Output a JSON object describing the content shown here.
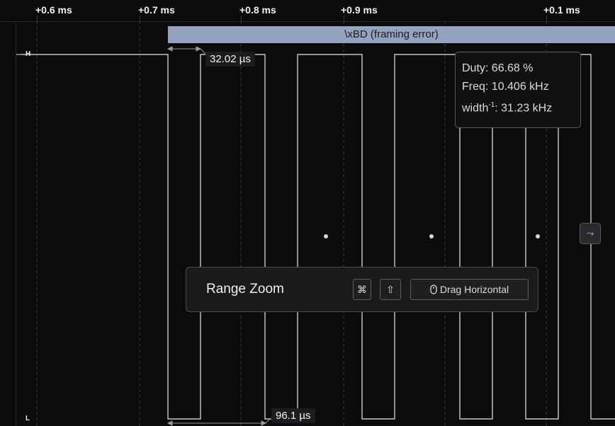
{
  "time_axis": {
    "ticks": [
      "+0.6 ms",
      "+0.7 ms",
      "+0.8 ms",
      "+0.9 ms",
      "+0.1 ms"
    ]
  },
  "levels": {
    "high": "H",
    "low": "L"
  },
  "decoder": {
    "label": "\\xBD (framing error)",
    "color": "#93a3bd"
  },
  "measurements": {
    "pulse_width": "32.02 µs",
    "period": "96.1 µs"
  },
  "stats": {
    "duty": "Duty: 66.68 %",
    "freq": "Freq: 10.406 kHz",
    "width_inverse_prefix": "width",
    "width_inverse_sup": "-1",
    "width_inverse_value": ": 31.23 kHz"
  },
  "side_button": {
    "icon": "measure-toggle-icon",
    "glyph": "⤳"
  },
  "range_zoom": {
    "title": "Range Zoom",
    "key_cmd": "⌘",
    "key_shift": "⇧",
    "key_drag": "Drag Horizontal",
    "mouse_icon": "mouse-icon"
  },
  "colors": {
    "background": "#0b0b0c",
    "signal": "#e8e8ea",
    "gridline": "#4a4a52"
  }
}
